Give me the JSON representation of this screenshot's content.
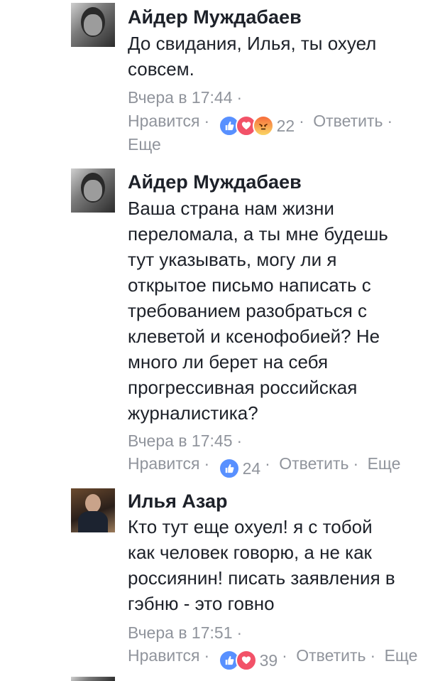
{
  "comments": [
    {
      "author": "Айдер Муждабаев",
      "lines": [
        "До свидания, Илья, ты охуел",
        "совсем."
      ],
      "time": "Вчера в 17:44",
      "like_label": "Нравится",
      "reaction_icons": [
        "like-icon",
        "love-icon",
        "angry-icon"
      ],
      "reaction_count": "22",
      "reply_label": "Ответить",
      "more_label": "Еще"
    },
    {
      "author": "Айдер Муждабаев",
      "lines": [
        "Ваша страна нам жизни",
        "переломала, а ты мне будешь",
        "тут указывать, могу ли я",
        "открытое письмо написать с",
        "требованием разобраться с",
        "клеветой и ксенофобией? Не",
        "много ли берет на себя",
        "прогрессивная российская",
        "журналистика?"
      ],
      "time": "Вчера в 17:45",
      "like_label": "Нравится",
      "reaction_icons": [
        "like-icon"
      ],
      "reaction_count": "24",
      "reply_label": "Ответить",
      "more_label": "Еще"
    },
    {
      "author": "Илья Азар",
      "lines": [
        "Кто тут еще охуел! я с тобой",
        "как человек говорю, а не как",
        "россиянин! писать заявления в",
        "гэбню - это говно"
      ],
      "time": "Вчера в 17:51",
      "like_label": "Нравится",
      "reaction_icons": [
        "like-icon",
        "love-icon"
      ],
      "reaction_count": "39",
      "reply_label": "Ответить",
      "more_label": "Еще"
    }
  ],
  "colors": {
    "meta": "#90949c",
    "text": "#1d2129",
    "like": "#5890ff",
    "love": "#f25268"
  }
}
